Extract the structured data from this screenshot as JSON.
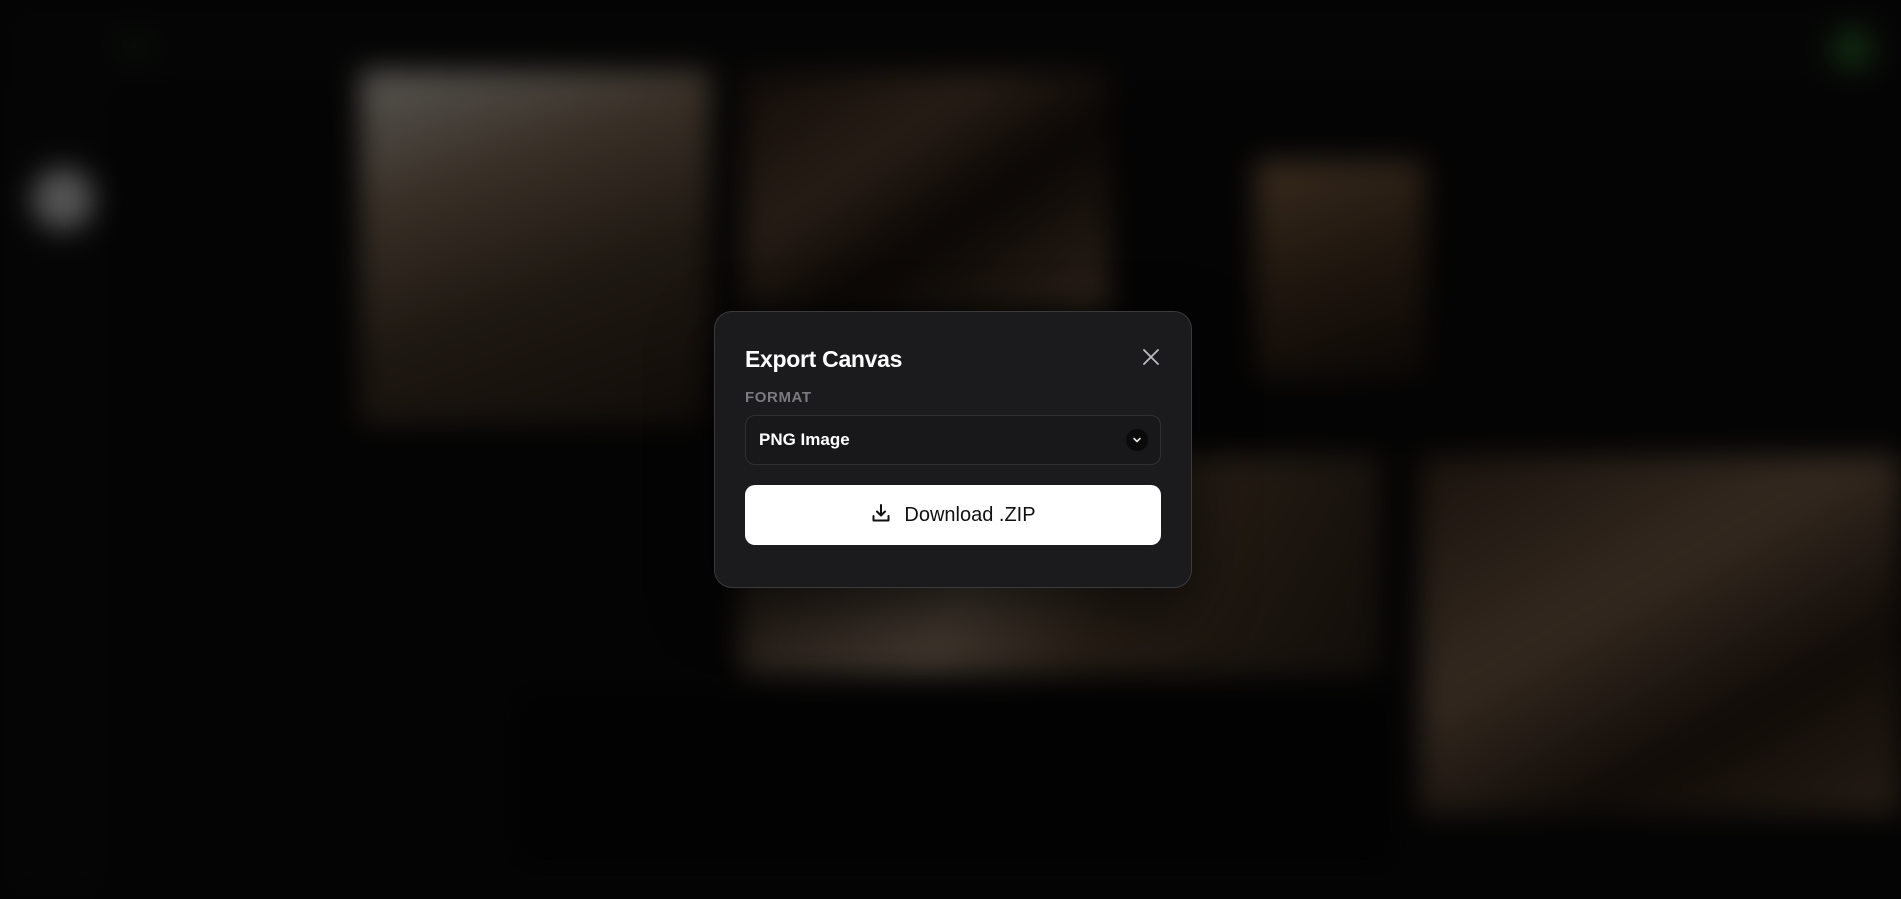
{
  "dialog": {
    "title": "Export Canvas",
    "close_icon": "close-icon",
    "format": {
      "label": "FORMAT",
      "selected": "PNG Image",
      "icon": "chevron-down-icon"
    },
    "download": {
      "label": "Download .ZIP",
      "icon": "download-icon"
    }
  },
  "colors": {
    "modal_bg": "#1b1b1d",
    "modal_border": "#3a3a3d",
    "primary_button_bg": "#ffffff",
    "label_muted": "#7a7a80"
  }
}
